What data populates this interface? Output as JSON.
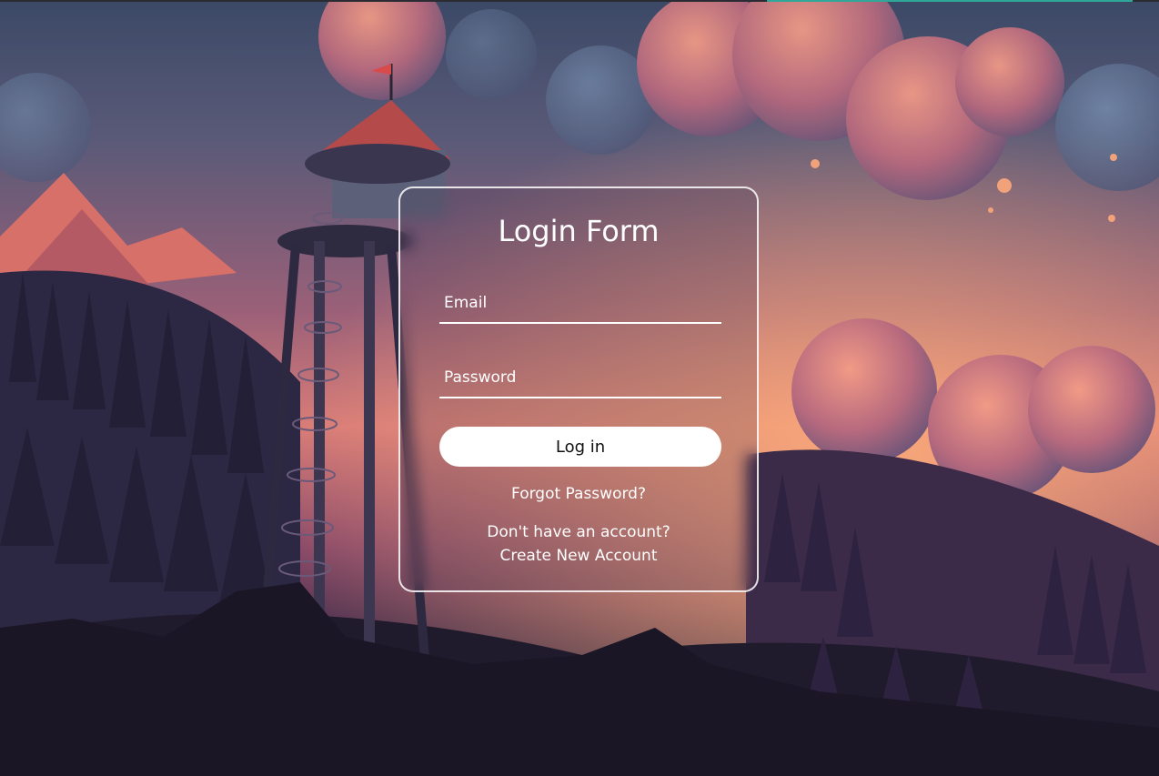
{
  "login_form": {
    "title": "Login Form",
    "email_placeholder": "Email",
    "password_placeholder": "Password",
    "login_label": "Log in",
    "forgot_password": "Forgot Password?",
    "no_account_text": "Don't have an account?",
    "create_account": "Create New Account"
  },
  "background": {
    "scene": "illustrated forest with lookout tower at sunset",
    "icons": [
      "flag-icon",
      "tower-illustration"
    ]
  },
  "colors": {
    "card_border": "#ffffff",
    "button_bg": "#ffffff",
    "button_text": "#111111",
    "text": "#ffffff",
    "accent_line": "#2fa89a"
  }
}
